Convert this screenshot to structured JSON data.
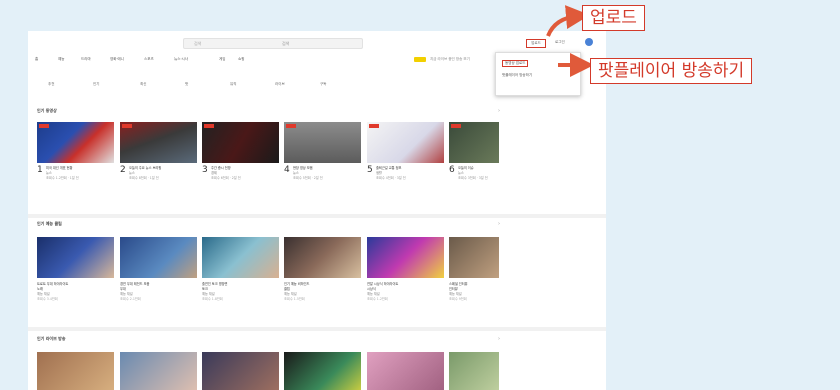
{
  "top": {
    "search_placeholder": "검색",
    "search_mid": "검색",
    "upload_label": "업로드",
    "login_label": "로그인",
    "categories": [
      "홈",
      "예능",
      "드라마",
      "영화·애니",
      "스포츠",
      "뉴스·시사",
      "게임",
      "쇼핑"
    ],
    "live_text": "지금 라이브 중인 방송 보기",
    "subnav": [
      "추천",
      "인기",
      "최신",
      "팟",
      "뮤직",
      "라이브",
      "구독"
    ]
  },
  "dropdown": {
    "items": [
      "동영상 업로드",
      "팟플레이어 방송하기"
    ]
  },
  "callouts": {
    "upload": "업로드",
    "broadcast": "팟플레이어 방송하기"
  },
  "sections": [
    {
      "title": "인기 동영상",
      "more": "›",
      "videos": [
        {
          "rank": "1",
          "title": "미국 대선 개표 현황",
          "sub": "뉴스",
          "stats": "조회수 1.2만회 · 1일 전"
        },
        {
          "rank": "2",
          "title": "오늘의 주요 뉴스 브리핑",
          "sub": "뉴스",
          "stats": "조회수 8천회 · 1일 전"
        },
        {
          "rank": "3",
          "title": "주간 증시 전망",
          "sub": "경제",
          "stats": "조회수 6천회 · 2일 전"
        },
        {
          "rank": "4",
          "title": "현장 영상 모음",
          "sub": "뉴스",
          "stats": "조회수 5천회 · 2일 전"
        },
        {
          "rank": "5",
          "title": "출퇴근길 교통 정보",
          "sub": "생활",
          "stats": "조회수 4천회 · 3일 전"
        },
        {
          "rank": "6",
          "title": "오늘의 이슈",
          "sub": "뉴스",
          "stats": "조회수 3천회 · 3일 전"
        }
      ]
    },
    {
      "title": "인기 예능 클립",
      "more": "›",
      "videos": [
        {
          "title": "트로트 무대 하이라이트",
          "sub": "노래",
          "stats": "예능 채널",
          "views": "조회수 3.4만회"
        },
        {
          "title": "경연 무대 레전드 모음",
          "sub": "무대",
          "stats": "예능 채널",
          "views": "조회수 2.1만회"
        },
        {
          "title": "출연진 토크 명장면",
          "sub": "토크",
          "stats": "예능 채널",
          "views": "조회수 1.8만회"
        },
        {
          "title": "인기 예능 비하인드",
          "sub": "클립",
          "stats": "예능 채널",
          "views": "조회수 1.5만회"
        },
        {
          "title": "연말 시상식 하이라이트",
          "sub": "시상식",
          "stats": "예능 채널",
          "views": "조회수 1.2만회"
        },
        {
          "title": "스페셜 인터뷰",
          "sub": "인터뷰",
          "stats": "예능 채널",
          "views": "조회수 9천회"
        }
      ]
    },
    {
      "title": "인기 라이브 방송",
      "more": "›"
    }
  ]
}
